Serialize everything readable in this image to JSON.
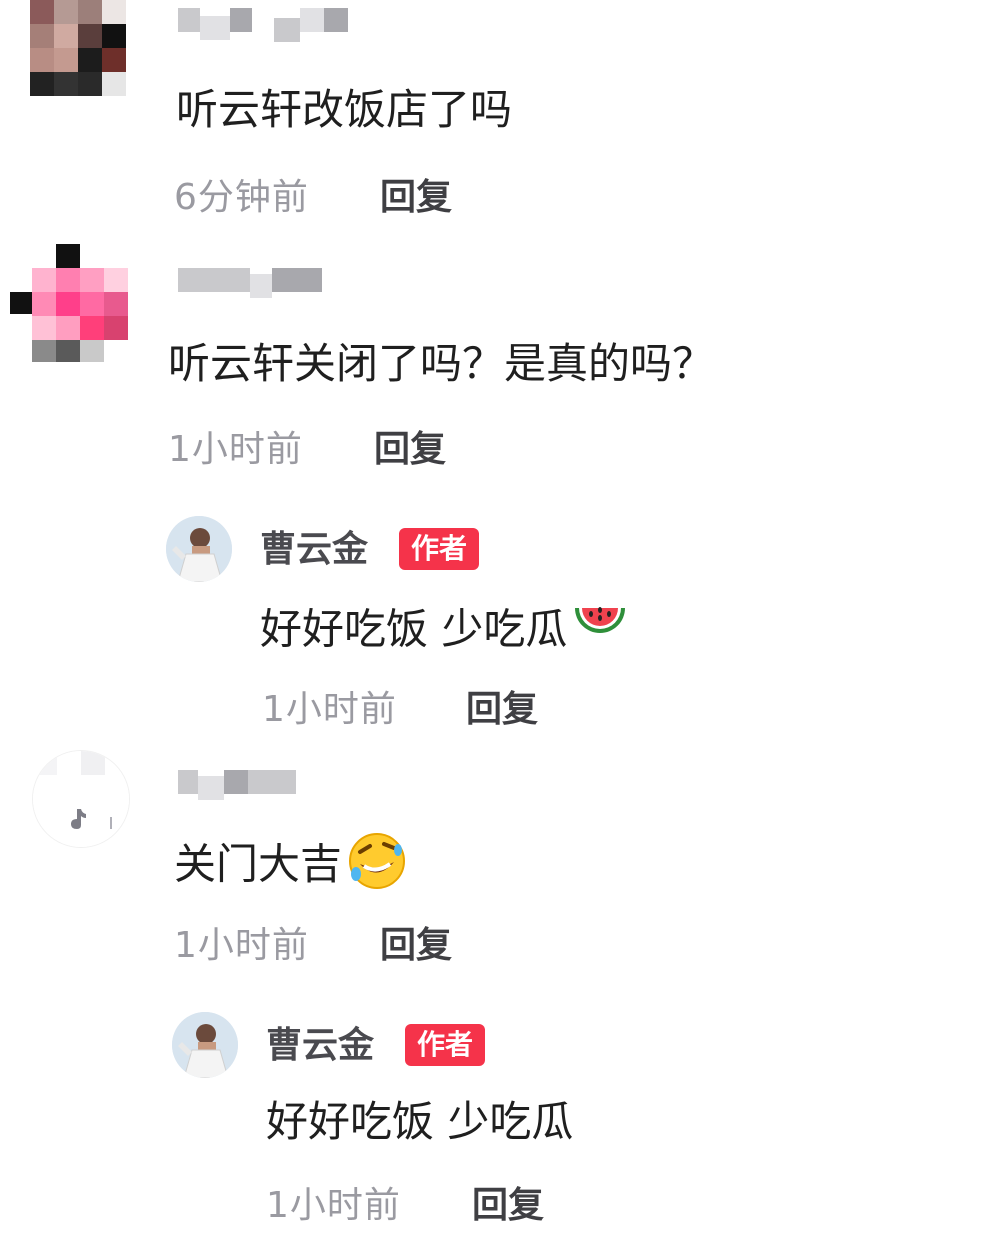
{
  "comments": [
    {
      "text": "听云轩改饭店了吗",
      "time": "6分钟前",
      "reply": "回复"
    },
    {
      "text": "听云轩关闭了吗？是真的吗？",
      "time": "1小时前",
      "reply": "回复",
      "author_reply": {
        "name": "曹云金",
        "badge": "作者",
        "text": "好好吃饭 少吃瓜",
        "emoji": "watermelon-emoji",
        "time": "1小时前",
        "reply": "回复"
      }
    },
    {
      "text": "关门大吉",
      "emoji": "rolling-on-floor-laughing-emoji",
      "time": "1小时前",
      "reply": "回复",
      "author_reply": {
        "name": "曹云金",
        "badge": "作者",
        "text": "好好吃饭 少吃瓜",
        "time": "1小时前",
        "reply": "回复"
      }
    }
  ],
  "colors": {
    "badge": "#f5334a",
    "time": "#9a9aa1",
    "text": "#1f1f1f"
  }
}
